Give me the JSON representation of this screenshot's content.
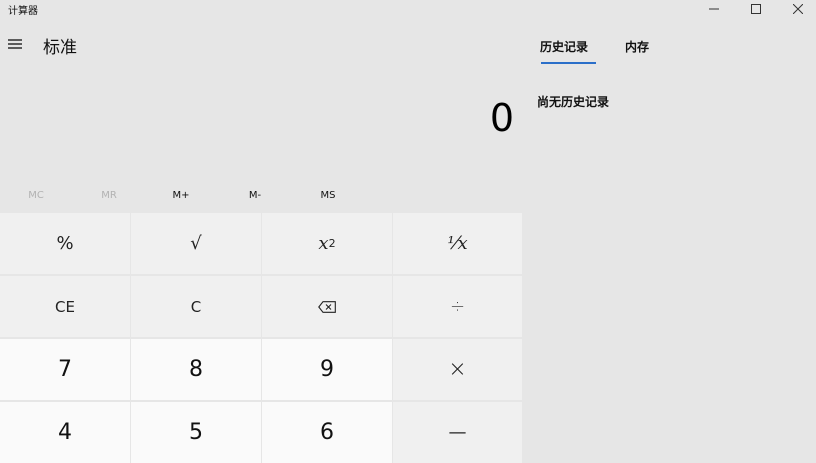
{
  "window": {
    "title": "计算器",
    "controls": {
      "minimize_icon": "minimize-icon",
      "maximize_icon": "maximize-icon",
      "close_icon": "close-icon"
    }
  },
  "header": {
    "menu_icon": "hamburger-menu-icon",
    "mode": "标准"
  },
  "display": {
    "value": "0"
  },
  "memory": {
    "mc": "MC",
    "mr": "MR",
    "mplus": "M+",
    "mminus": "M-",
    "ms": "MS"
  },
  "keys": {
    "percent": "%",
    "sqrt": "√",
    "square_base": "x",
    "square_exp": "2",
    "reciprocal": "⅟x",
    "ce": "CE",
    "c": "C",
    "backspace_icon": "backspace-icon",
    "divide": "÷",
    "seven": "7",
    "eight": "8",
    "nine": "9",
    "multiply": "×",
    "four": "4",
    "five": "5",
    "six": "6",
    "minus": "—"
  },
  "history_panel": {
    "tabs": [
      {
        "label": "历史记录",
        "active": true
      },
      {
        "label": "内存",
        "active": false
      }
    ],
    "empty_message": "尚无历史记录",
    "accent_color": "#2b6fc9"
  }
}
